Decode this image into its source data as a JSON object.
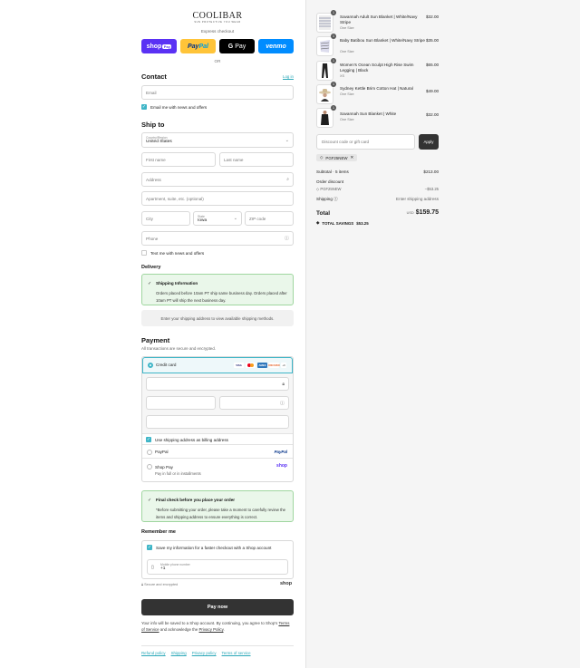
{
  "brand": {
    "name": "COOLIBAR",
    "tagline": "SUN PROTECTIVE YOU WEAR"
  },
  "express": {
    "label": "Express checkout",
    "shop": "shop",
    "shop_tag": "Pay",
    "paypal_a": "Pay",
    "paypal_b": "Pal",
    "gpay_g": "G",
    "gpay": "Pay",
    "venmo": "venmo",
    "or": "OR"
  },
  "contact": {
    "title": "Contact",
    "login": "Log in",
    "email_placeholder": "Email",
    "news_label": "Email me with news and offers"
  },
  "shipto": {
    "title": "Ship to",
    "country_label": "Country/Region",
    "country_value": "United States",
    "first_name": "First name",
    "last_name": "Last name",
    "address": "Address",
    "apartment": "Apartment, suite, etc. (optional)",
    "city": "City",
    "state_label": "State",
    "state_value": "Iowa",
    "zip": "ZIP code",
    "phone": "Phone",
    "text_label": "Text me with news and offers"
  },
  "delivery": {
    "title": "Delivery",
    "notice_title": "Shipping Information",
    "notice_body": "Orders placed before 10am PT ship same business day. Orders placed after 10am PT will ship the next business day.",
    "placeholder": "Enter your shipping address to view available shipping methods."
  },
  "payment": {
    "title": "Payment",
    "subtitle": "All transactions are secure and encrypted.",
    "credit_card": "Credit card",
    "card_brands": [
      "VISA",
      "MC",
      "AMEX",
      "DISCOVER",
      "+3"
    ],
    "billing_label": "Use shipping address as billing address",
    "paypal": "PayPal",
    "paypal_logo": "PayPal",
    "shoppay": "Shop Pay",
    "shoppay_sub": "Pay in full or in installments",
    "shop_logo": "shop"
  },
  "final_check": {
    "title": "Final check before you place your order",
    "body": "*Before submitting your order, please take a moment to carefully review the items and shipping address to ensure everything is correct."
  },
  "remember": {
    "title": "Remember me",
    "save_label": "Save my information for a faster checkout with a Shop account",
    "mobile_label": "Mobile phone number",
    "mobile_value": "+1",
    "secure": "Secure and encrypted",
    "shop": "shop"
  },
  "paynow": "Pay now",
  "legal": {
    "text1": "Your info will be saved to a Shop account. By continuing, you agree to Shop's",
    "terms": "Terms of Service",
    "text2": "and acknowledge the",
    "privacy": "Privacy Policy",
    "dot": "."
  },
  "footer": [
    "Refund policy",
    "Shipping",
    "Privacy policy",
    "Terms of service"
  ],
  "cart": {
    "items": [
      {
        "qty": "1",
        "name": "Savannah Adult Sun Blanket | White/Navy Stripe",
        "variant": "One Size",
        "price": "$32.00"
      },
      {
        "qty": "1",
        "name": "Baby Batibou Sun Blanket | White/Navy Stripe",
        "variant": "One Size",
        "price": "$35.00"
      },
      {
        "qty": "1",
        "name": "Women's Ocean Sculpt High Rise Swim Legging | Black",
        "variant": "XS",
        "price": "$65.00"
      },
      {
        "qty": "1",
        "name": "Sydney Kettle Brim Cotton Hat | Natural",
        "variant": "One Size",
        "price": "$49.00"
      },
      {
        "qty": "1",
        "name": "Savannah Sun Blanket | White",
        "variant": "One Size",
        "price": "$32.00"
      }
    ],
    "discount_placeholder": "Discount code or gift card",
    "apply": "Apply",
    "code": "PGF25NEW",
    "subtotal_label": "Subtotal · 5 items",
    "subtotal": "$213.00",
    "order_discount": "Order discount",
    "code_label": "PGF25NEW",
    "code_amount": "−$53.25",
    "shipping_label": "Shipping",
    "shipping_value": "Enter shipping address",
    "total_label": "Total",
    "currency": "USD",
    "total": "$159.75",
    "savings_label": "TOTAL SAVINGS",
    "savings": "$53.25"
  }
}
